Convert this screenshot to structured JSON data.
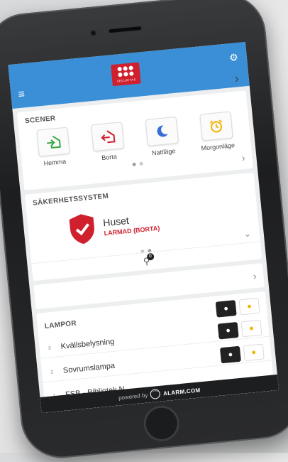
{
  "header": {
    "logo_text": "SECURITAS"
  },
  "scenes": {
    "title": "SCENER",
    "items": [
      {
        "label": "Hemma",
        "icon": "home-arrow-in-icon",
        "color": "#3aa845"
      },
      {
        "label": "Borta",
        "icon": "home-arrow-out-icon",
        "color": "#d0202e"
      },
      {
        "label": "Nattläge",
        "icon": "moon-icon",
        "color": "#3a6ed6"
      },
      {
        "label": "Morgonläge",
        "icon": "alarm-clock-icon",
        "color": "#f1b400"
      }
    ]
  },
  "security": {
    "title": "SÄKERHETSSYSTEM",
    "name": "Huset",
    "status": "LARMAD (BORTA)",
    "status_color": "#d0202e",
    "sensor_count": "0"
  },
  "lights": {
    "title": "LAMPOR",
    "items": [
      {
        "name": "Kvällsbelysning"
      },
      {
        "name": "Sovrumslampa"
      },
      {
        "name": "FSB - Bibliotek N"
      }
    ]
  },
  "footer": {
    "powered_by": "powered by",
    "brand": "ALARM.COM"
  }
}
